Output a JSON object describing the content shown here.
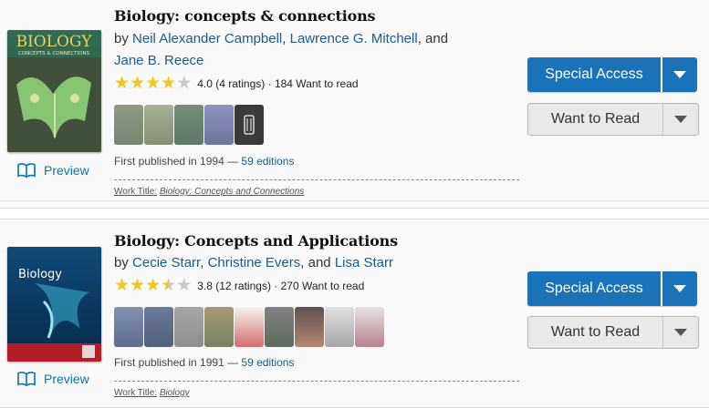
{
  "books": [
    {
      "title": "Biology: concepts & connections",
      "by": "by",
      "authors": [
        "Neil Alexander Campbell",
        "Lawrence G. Mitchell",
        "Jane B. Reece"
      ],
      "sep1": ",",
      "and": ", and",
      "rating": 4.0,
      "rating_text": "4.0 (4 ratings)",
      "want_text": "· 184 Want to read",
      "first_published": "First published in 1994 —",
      "editions_link": "59 editions",
      "work_title_label": "Work Title:",
      "work_title_value": "Biology: Concepts and Connections",
      "preview_label": "Preview",
      "special_access_label": "Special Access",
      "want_to_read_label": "Want to Read",
      "cover_text": "BIOLOGY",
      "cover_subtext": "CONCEPTS & CONNECTIONS"
    },
    {
      "title": "Biology: Concepts and Applications",
      "by": "by",
      "authors": [
        "Cecie Starr",
        "Christine Evers",
        "Lisa Starr"
      ],
      "sep1": ",",
      "and": ", and",
      "rating": 3.8,
      "rating_text": "3.8 (12 ratings)",
      "want_text": "· 270 Want to read",
      "first_published": "First published in 1991 —",
      "editions_link": "59 editions",
      "work_title_label": "Work Title:",
      "work_title_value": "Biology",
      "preview_label": "Preview",
      "special_access_label": "Special Access",
      "want_to_read_label": "Want to Read",
      "cover_text": "Biology"
    }
  ],
  "colors": {
    "link": "#1c5a8a",
    "accent_button": "#1a73b8",
    "star": "#f5c518",
    "preview": "#0376b8"
  },
  "icons": {
    "preview": "book-open-icon",
    "dropdown": "triangle-down-icon",
    "star": "star-icon"
  }
}
